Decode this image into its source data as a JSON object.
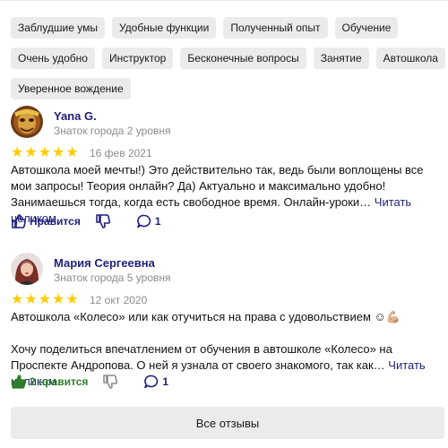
{
  "tags": {
    "row1": [
      "Заблудшие умы",
      "Удобные функции",
      "Полученный опыт",
      "Обучение"
    ],
    "row2": [
      "Очень удобно",
      "Инструктор",
      "Бесконечные вопросы",
      "Занятие",
      "Автошкола"
    ],
    "row3": [
      "Уверенное вождение"
    ]
  },
  "reviews": [
    {
      "author": "Yana G.",
      "level": "Знаток города 2 уровня",
      "rating": 5,
      "date": "16 фев 2021",
      "text": "Автошкола моей мечты!) Это действительно так, ведь были воплощены все мои запросы! Теория онлайн? Да) Актуально и максимально удобно! Занимаешься тогда, когда есть свободное время. Онлайн-уроки…",
      "read_more": "Читать целиком",
      "like_label": "Нравится",
      "comments": "1"
    },
    {
      "author": "Мария Сергеевна",
      "level": "Знаток города 5 уровня",
      "rating": 5,
      "date": "12 окт 2020",
      "text_p1": "Автошкола «Колесо» или как отучиться на права с удовольствием ☺💪🏼",
      "text_p2": "Хочу поделиться впечатлением от обучения в автошколе «Колесо» на Проспекте Андропова. О ней я узнала от своего знакомого, так как…",
      "read_more": "Читать целиком",
      "like_label": "2 нравится",
      "comments": "1"
    }
  ],
  "all_reviews_button": "Все отзывы",
  "colors": {
    "accent": "#1f1f7a",
    "liked": "#2d7d2d",
    "star": "#ffcc00",
    "tag_bg": "#ebebeb"
  }
}
